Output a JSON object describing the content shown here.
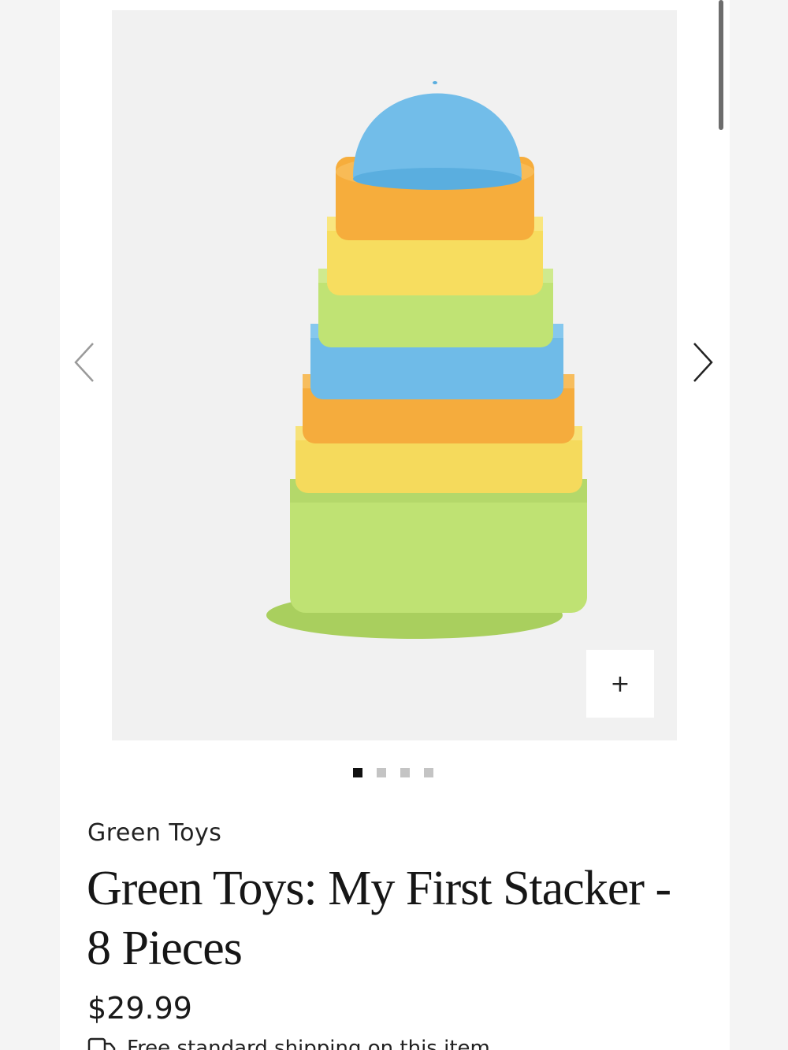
{
  "product": {
    "brand": "Green Toys",
    "title": "Green Toys: My First Stacker - 8 Pieces",
    "price": "$29.99",
    "shipping_text": "Free standard shipping on this item"
  },
  "gallery": {
    "zoom_label": "+",
    "image_count": 4,
    "active_index": 0,
    "prev_icon": "chevron-left-icon",
    "next_icon": "chevron-right-icon"
  },
  "colors": {
    "blue": "#6fbce9",
    "orange": "#f6ae3c",
    "yellow": "#f7dc5c",
    "green": "#bde36f",
    "page_bg": "#ffffff",
    "gallery_bg": "#f1f1f1"
  }
}
